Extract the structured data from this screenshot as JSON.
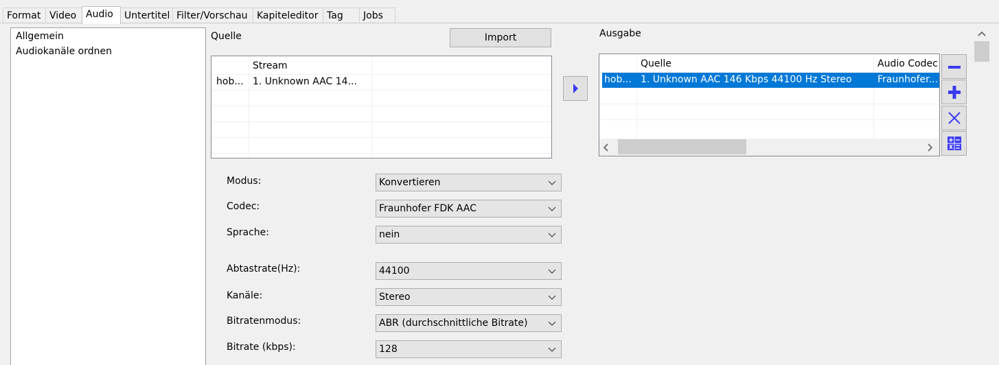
{
  "tabs": [
    "Format",
    "Video",
    "Audio",
    "Untertitel",
    "Filter/Vorschau",
    "Kapiteleditor",
    "Tag",
    "Jobs"
  ],
  "active_tab": "Audio",
  "nav": [
    "Allgemein",
    "Audiokanäle ordnen"
  ],
  "source": {
    "label": "Quelle",
    "import_button": "Import",
    "header_stream": "Stream",
    "row_file": "hob...",
    "row_stream": "1. Unknown AAC  14..."
  },
  "output": {
    "label": "Ausgabe",
    "header_source": "Quelle",
    "header_codec": "Audio Codec",
    "row_file": "hob...",
    "row_source": "1. Unknown AAC  146 Kbps 44100 Hz Stereo",
    "row_codec": "Fraunhofer..."
  },
  "settings": [
    {
      "label": "Modus:",
      "value": "Konvertieren"
    },
    {
      "label": "Codec:",
      "value": "Fraunhofer FDK AAC"
    },
    {
      "label": "Sprache:",
      "value": "nein"
    },
    {
      "label": "Abtastrate(Hz):",
      "value": "44100"
    },
    {
      "label": "Kanäle:",
      "value": "Stereo"
    },
    {
      "label": "Bitratenmodus:",
      "value": "ABR (durchschnittliche Bitrate)"
    },
    {
      "label": "Bitrate (kbps):",
      "value": "128"
    }
  ],
  "colors": {
    "selection": "#0078d7",
    "icon_blue": "#3a3af0"
  },
  "icons": [
    "chevron-right-icon",
    "minus-icon",
    "plus-icon",
    "x-icon",
    "calculator-icon",
    "chevron-down-icon",
    "scroll-left-icon",
    "scroll-right-icon"
  ]
}
